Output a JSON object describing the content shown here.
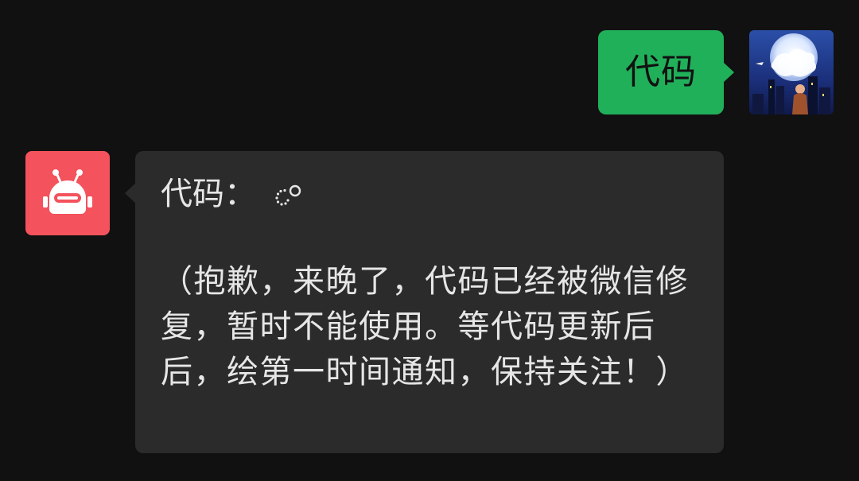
{
  "outgoing": {
    "text": "代码"
  },
  "incoming": {
    "head": "代码：",
    "body": "（抱歉，来晚了，代码已经被微信修复，暂时不能使用。等代码更新后后，绘第一时间通知，保持关注！）"
  },
  "colors": {
    "background": "#111111",
    "outgoing_bubble": "#21b05a",
    "incoming_bubble": "#2b2b2b",
    "bot_avatar": "#f4525c"
  },
  "icons": {
    "bot_avatar": "robot-icon",
    "user_avatar": "night-city-moon-avatar",
    "typing": "loading-dots-icon"
  }
}
